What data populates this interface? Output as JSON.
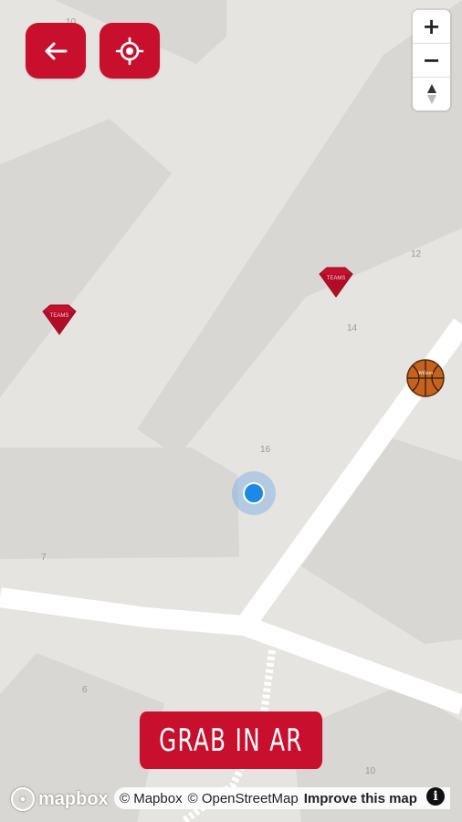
{
  "controls": {
    "back_icon": "arrow-left-icon",
    "locate_icon": "crosshair-icon",
    "zoom_in": "+",
    "zoom_out": "−",
    "compass_icon": "compass-icon"
  },
  "map": {
    "house_numbers": [
      "10",
      "12",
      "14",
      "16",
      "7",
      "6",
      "10"
    ],
    "markers": [
      {
        "type": "gem",
        "label": "TEAMS"
      },
      {
        "type": "gem",
        "label": "TEAMS"
      },
      {
        "type": "basketball",
        "label": "Wilson"
      }
    ]
  },
  "action": {
    "label": "GRAB IN AR"
  },
  "attribution": {
    "logo": "mapbox",
    "mapbox": "© Mapbox",
    "osm": "© OpenStreetMap",
    "improve": "Improve this map",
    "info": "i"
  },
  "colors": {
    "brand_red": "#c8102e",
    "user_dot": "#1e88e5",
    "map_bg": "#e6e4e0",
    "building": "#d9d7d3",
    "road": "#ffffff"
  }
}
